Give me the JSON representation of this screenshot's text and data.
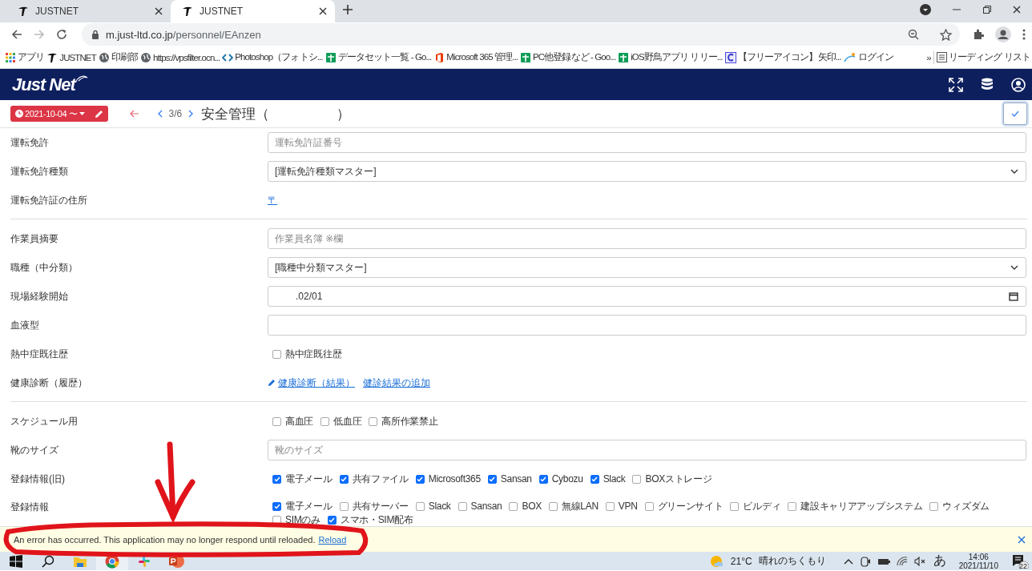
{
  "browser": {
    "tabs": [
      {
        "title": "JUSTNET",
        "selected": false
      },
      {
        "title": "JUSTNET",
        "selected": true
      }
    ],
    "url_host": "m.just-ltd.co.jp",
    "url_path": "/personnel/EAnzen",
    "bookmarks": [
      {
        "kind": "apps",
        "label": "アプリ"
      },
      {
        "kind": "site",
        "label": "JUSTNET"
      },
      {
        "kind": "globe",
        "label": "印刷部"
      },
      {
        "kind": "globe",
        "label": "https://vpsfilter.ocn..."
      },
      {
        "kind": "code",
        "label": "Photoshop（フォトシ..."
      },
      {
        "kind": "sheet",
        "label": "データセット一覧 - Go..."
      },
      {
        "kind": "office",
        "label": "Microsoft 365 管理..."
      },
      {
        "kind": "sheet",
        "label": "PC他登録など - Goo..."
      },
      {
        "kind": "sheet",
        "label": "iOS野鳥アプリ リリー..."
      },
      {
        "kind": "letter",
        "label": "【フリーアイコン】矢印..."
      },
      {
        "kind": "wave",
        "label": "ログイン"
      }
    ],
    "bookmarks_more": "»",
    "reading_list": "リーディング リスト"
  },
  "app": {
    "logo": "Just Net"
  },
  "toolbar": {
    "date_button": "2021-10-04 〜",
    "pager": "3/6",
    "title": "安全管理（",
    "title_close": "）"
  },
  "form": {
    "sections": [
      {
        "rows": [
          {
            "label": "運転免許",
            "kind": "input",
            "placeholder": "運転免許証番号"
          },
          {
            "label": "運転免許種類",
            "kind": "select",
            "value": "[運転免許種類マスター]"
          },
          {
            "label": "運転免許証の住所",
            "kind": "links",
            "links": [
              {
                "label": "〒",
                "kind": "plain"
              }
            ]
          }
        ]
      },
      {
        "rows": [
          {
            "label": "作業員摘要",
            "kind": "input",
            "placeholder": "作業員名簿 ※欄"
          },
          {
            "label": "職種（中分類）",
            "kind": "select",
            "value": "[職種中分類マスター]"
          },
          {
            "label": "現場経験開始",
            "kind": "date",
            "value": ".02/01"
          },
          {
            "label": "血液型",
            "kind": "input"
          },
          {
            "label": "熱中症既往歴",
            "kind": "checks",
            "options": [
              {
                "label": "熱中症既往歴",
                "checked": false
              }
            ]
          },
          {
            "label": "健康診断（履歴）",
            "kind": "links",
            "links": [
              {
                "label": "健康診断（結果）",
                "kind": "edit"
              },
              {
                "label": "健診結果の追加",
                "kind": "plain"
              }
            ]
          }
        ]
      },
      {
        "rows": [
          {
            "label": "スケジュール用",
            "kind": "checks",
            "options": [
              {
                "label": "高血圧",
                "checked": false
              },
              {
                "label": "低血圧",
                "checked": false
              },
              {
                "label": "高所作業禁止",
                "checked": false
              }
            ]
          },
          {
            "label": "靴のサイズ",
            "kind": "input",
            "placeholder": "靴のサイズ"
          },
          {
            "label": "登録情報(旧)",
            "kind": "checks",
            "options": [
              {
                "label": "電子メール",
                "checked": true
              },
              {
                "label": "共有ファイル",
                "checked": true
              },
              {
                "label": "Microsoft365",
                "checked": true
              },
              {
                "label": "Sansan",
                "checked": true
              },
              {
                "label": "Cybozu",
                "checked": true
              },
              {
                "label": "Slack",
                "checked": true
              },
              {
                "label": "BOXストレージ",
                "checked": false
              }
            ]
          },
          {
            "label": "登録情報",
            "kind": "checks",
            "options": [
              {
                "label": "電子メール",
                "checked": true
              },
              {
                "label": "共有サーバー",
                "checked": false
              },
              {
                "label": "Slack",
                "checked": false
              },
              {
                "label": "Sansan",
                "checked": false
              },
              {
                "label": "BOX",
                "checked": false
              },
              {
                "label": "無線LAN",
                "checked": false
              },
              {
                "label": "VPN",
                "checked": false
              },
              {
                "label": "グリーンサイト",
                "checked": false
              },
              {
                "label": "ビルディ",
                "checked": false
              },
              {
                "label": "建設キャリアアップシステム",
                "checked": false
              },
              {
                "label": "ウィズダム",
                "checked": false
              },
              {
                "label": "SIMのみ",
                "checked": false
              },
              {
                "label": "スマホ・SIM配布",
                "checked": true
              }
            ]
          }
        ]
      }
    ]
  },
  "error": {
    "message": "An error has occurred. This application may no longer respond until reloaded.",
    "link": "Reload"
  },
  "taskbar": {
    "temperature": "21°C",
    "forecast": "晴れのちくもり",
    "ime": "あ",
    "time": "14:06",
    "date": "2021/11/10",
    "notifications": "22"
  }
}
